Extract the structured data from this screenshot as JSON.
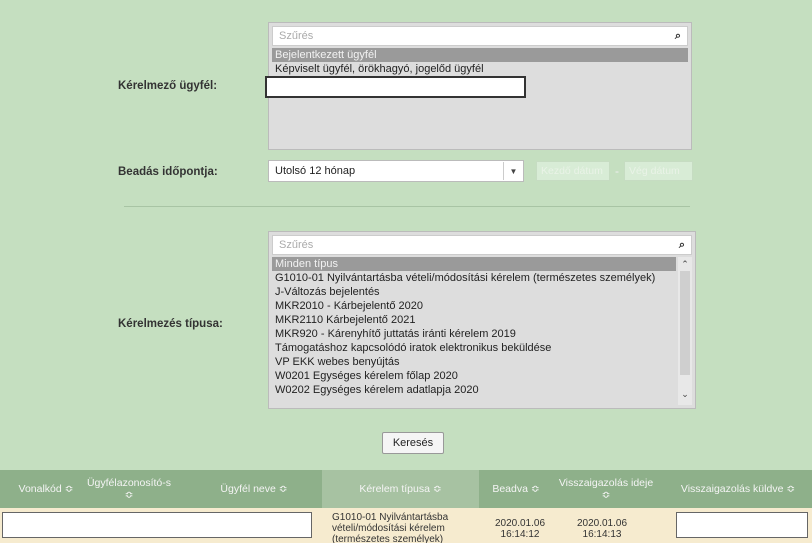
{
  "applicant": {
    "label": "Kérelmező ügyfél:",
    "search_placeholder": "Szűrés",
    "options": [
      "Bejelentkezett ügyfél",
      "Képviselt ügyfél, örökhagyó, jogelőd ügyfél"
    ],
    "selected_index": 0,
    "overlay_value": ""
  },
  "submission": {
    "label": "Beadás időpontja:",
    "period_value": "Utolsó 12 hónap",
    "start_placeholder": "Kezdő dátum",
    "separator": "-",
    "end_placeholder": "Vég dátum"
  },
  "request_type": {
    "label": "Kérelmezés típusa:",
    "search_placeholder": "Szűrés",
    "options": [
      "Minden típus",
      "G1010-01 Nyilvántartásba vételi/módosítási kérelem (természetes személyek)",
      "J-Változás bejelentés",
      "MKR2010 - Kárbejelentő 2020",
      "MKR2110 Kárbejelentő 2021",
      "MKR920 - Kárenyhítő juttatás iránti kérelem 2019",
      "Támogatáshoz kapcsolódó iratok elektronikus beküldése",
      "VP EKK webes benyújtás",
      "W0201 Egységes kérelem főlap 2020",
      "W0202 Egységes kérelem adatlapja 2020"
    ],
    "selected_index": 0
  },
  "search_button": "Keresés",
  "table": {
    "headers": [
      "Vonalkód ≎",
      "Ügyfélazonosító-s ≎",
      "Ügyfél neve ≎",
      "Kérelem típusa ≎",
      "Beadva ≎",
      "Visszaigazolás ideje ≎",
      "Visszaigazolás küldve ≎"
    ],
    "row": {
      "barcode": "",
      "client_id": "",
      "client_name": "",
      "request_type": "G1010-01 Nyilvántartásba vételi/módosítási kérelem (természetes személyek)",
      "submitted_date": "2020.01.06",
      "submitted_time": "16:14:12",
      "confirmed_date": "2020.01.06",
      "confirmed_time": "16:14:13",
      "confirmation_sent": ""
    }
  },
  "colors": {
    "background": "#c5dfc0",
    "table_header": "#8eb08a",
    "highlight_row": "#f6ebcf",
    "selected_option": "#9a9a9a"
  },
  "icons": {
    "search": "search-icon",
    "dropdown": "chevron-down-icon",
    "sort": "sort-icon"
  }
}
